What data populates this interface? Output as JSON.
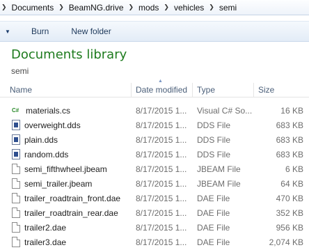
{
  "address": {
    "crumbs": [
      "Documents",
      "BeamNG.drive",
      "mods",
      "vehicles",
      "semi"
    ]
  },
  "toolbar": {
    "burn_label": "Burn",
    "new_folder_label": "New folder"
  },
  "library": {
    "title": "Documents library",
    "subtitle": "semi"
  },
  "columns": {
    "name": "Name",
    "date": "Date modified",
    "type": "Type",
    "size": "Size"
  },
  "files": [
    {
      "name": "materials.cs",
      "date": "8/17/2015 1...",
      "type": "Visual C# So...",
      "size": "16 KB",
      "icon": "csharp-file-icon"
    },
    {
      "name": "overweight.dds",
      "date": "8/17/2015 1...",
      "type": "DDS File",
      "size": "683 KB",
      "icon": "dds-file-icon"
    },
    {
      "name": "plain.dds",
      "date": "8/17/2015 1...",
      "type": "DDS File",
      "size": "683 KB",
      "icon": "dds-file-icon"
    },
    {
      "name": "random.dds",
      "date": "8/17/2015 1...",
      "type": "DDS File",
      "size": "683 KB",
      "icon": "dds-file-icon"
    },
    {
      "name": "semi_fifthwheel.jbeam",
      "date": "8/17/2015 1...",
      "type": "JBEAM File",
      "size": "6 KB",
      "icon": "generic-file-icon"
    },
    {
      "name": "semi_trailer.jbeam",
      "date": "8/17/2015 1...",
      "type": "JBEAM File",
      "size": "64 KB",
      "icon": "generic-file-icon"
    },
    {
      "name": "trailer_roadtrain_front.dae",
      "date": "8/17/2015 1...",
      "type": "DAE File",
      "size": "470 KB",
      "icon": "generic-file-icon"
    },
    {
      "name": "trailer_roadtrain_rear.dae",
      "date": "8/17/2015 1...",
      "type": "DAE File",
      "size": "352 KB",
      "icon": "generic-file-icon"
    },
    {
      "name": "trailer2.dae",
      "date": "8/17/2015 1...",
      "type": "DAE File",
      "size": "956 KB",
      "icon": "generic-file-icon"
    },
    {
      "name": "trailer3.dae",
      "date": "8/17/2015 1...",
      "type": "DAE File",
      "size": "2,074 KB",
      "icon": "generic-file-icon"
    }
  ]
}
